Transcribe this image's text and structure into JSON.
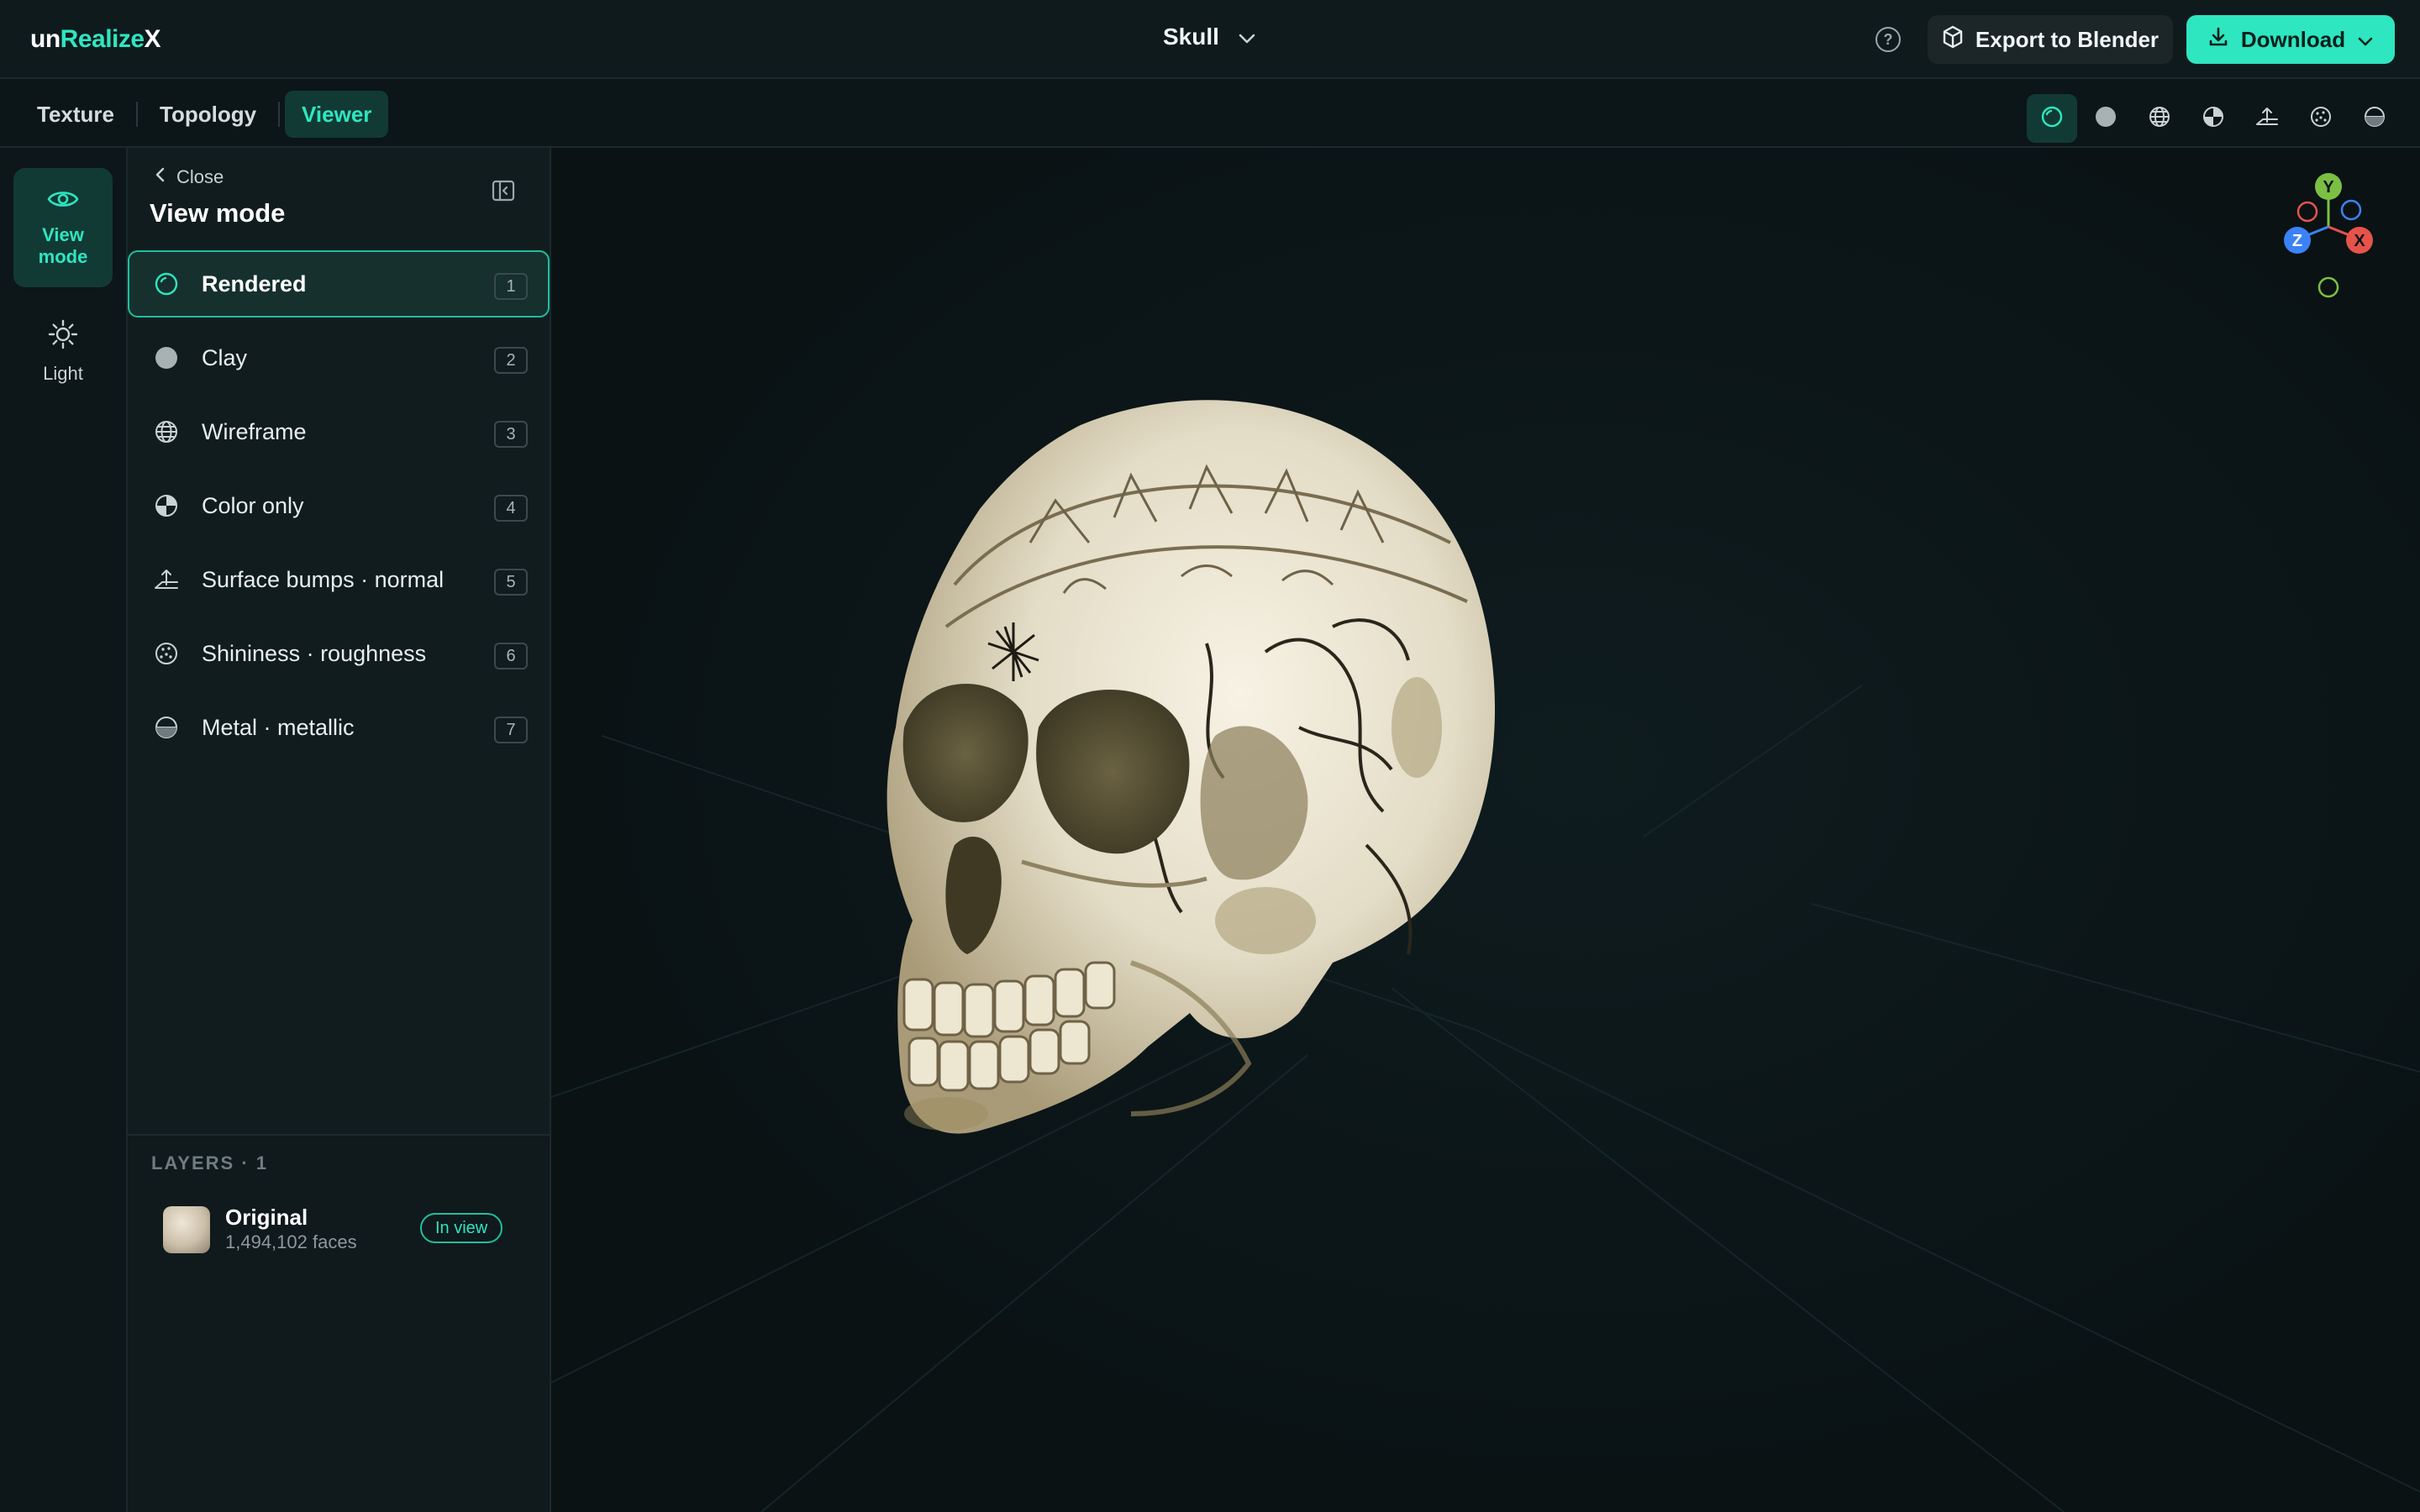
{
  "header": {
    "logo_part1": "un",
    "logo_part2": "Realize",
    "logo_part3": "X",
    "project_name": "Skull",
    "help_symbol": "?",
    "export_label": "Export to Blender",
    "download_label": "Download"
  },
  "tabs": [
    {
      "label": "Texture",
      "active": false
    },
    {
      "label": "Topology",
      "active": false
    },
    {
      "label": "Viewer",
      "active": true
    }
  ],
  "view_tools": [
    "rendered-icon",
    "clay-icon",
    "wireframe-icon",
    "color-only-icon",
    "normal-icon",
    "roughness-icon",
    "metallic-icon"
  ],
  "rail": {
    "view_mode_label": "View\nmode",
    "light_label": "Light"
  },
  "panel": {
    "close_label": "Close",
    "title": "View mode",
    "modes": [
      {
        "label": "Rendered",
        "key": "1",
        "icon": "rendered-icon",
        "active": true
      },
      {
        "label": "Clay",
        "key": "2",
        "icon": "clay-icon",
        "active": false
      },
      {
        "label": "Wireframe",
        "key": "3",
        "icon": "wireframe-icon",
        "active": false
      },
      {
        "label": "Color only",
        "key": "4",
        "icon": "color-only-icon",
        "active": false
      },
      {
        "label": "Surface bumps · normal",
        "key": "5",
        "icon": "normal-icon",
        "active": false
      },
      {
        "label": "Shininess · roughness",
        "key": "6",
        "icon": "roughness-icon",
        "active": false
      },
      {
        "label": "Metal · metallic",
        "key": "7",
        "icon": "metallic-icon",
        "active": false
      }
    ],
    "layers_title": "LAYERS · 1",
    "layer": {
      "name": "Original",
      "faces": "1,494,102 faces",
      "badge": "In view"
    }
  },
  "gizmo": {
    "y": "Y",
    "x": "X",
    "z": "Z"
  },
  "colors": {
    "accent": "#2ee6c0",
    "background": "#0b1417",
    "axis_x": "#e5534b",
    "axis_y": "#7bc043",
    "axis_z": "#3b82f6"
  }
}
